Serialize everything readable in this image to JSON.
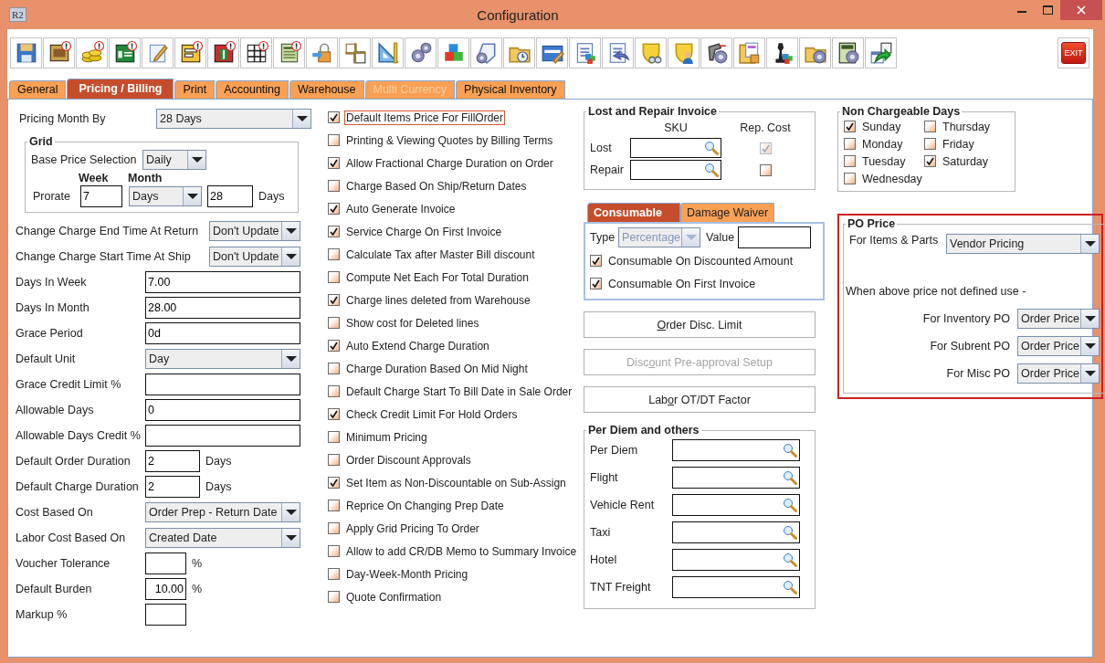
{
  "window": {
    "logo": "R2",
    "title": "Configuration"
  },
  "toolbar": {
    "exit_label": "EXIT"
  },
  "tabs": [
    {
      "label": "General",
      "selected": false,
      "disabled": false
    },
    {
      "label": "Pricing / Billing",
      "selected": true,
      "disabled": false
    },
    {
      "label": "Print",
      "selected": false,
      "disabled": false
    },
    {
      "label": "Accounting",
      "selected": false,
      "disabled": false
    },
    {
      "label": "Warehouse",
      "selected": false,
      "disabled": false
    },
    {
      "label": "Multi Currency",
      "selected": false,
      "disabled": true
    },
    {
      "label": "Physical Inventory",
      "selected": false,
      "disabled": false
    }
  ],
  "pricing_month_by": {
    "label": "Pricing Month By",
    "value": "28 Days"
  },
  "grid": {
    "title": "Grid",
    "base_price_label": "Base Price Selection",
    "base_price_value": "Daily",
    "week_heading": "Week",
    "month_heading": "Month",
    "prorate_label": "Prorate",
    "week_value": "7",
    "month_unit": "Days",
    "month_value": "28",
    "days_label": "Days"
  },
  "fields": [
    {
      "kind": "combo_small",
      "label": "Change Charge End Time At Return",
      "value": "Don't Update"
    },
    {
      "kind": "combo_small",
      "label": "Change Charge Start Time At Ship",
      "value": "Don't Update"
    },
    {
      "kind": "text",
      "label": "Days In Week",
      "value": "7.00"
    },
    {
      "kind": "text",
      "label": "Days In Month",
      "value": "28.00"
    },
    {
      "kind": "text",
      "label": "Grace Period",
      "value": "0d"
    },
    {
      "kind": "combo",
      "label": "Default Unit",
      "value": "Day"
    },
    {
      "kind": "text",
      "label": "Grace Credit Limit %"
    },
    {
      "kind": "text",
      "label": "Allowable Days",
      "value": "0"
    },
    {
      "kind": "text",
      "label": "Allowable Days Credit %"
    },
    {
      "kind": "short",
      "label": "Default Order Duration",
      "value": "2",
      "suffix": "Days"
    },
    {
      "kind": "short",
      "label": "Default Charge Duration",
      "value": "2",
      "suffix": "Days"
    },
    {
      "kind": "combo",
      "label": "Cost Based On",
      "value": "Order Prep - Return Date"
    },
    {
      "kind": "combo",
      "label": "Labor Cost Based On",
      "value": "Created Date"
    },
    {
      "kind": "number",
      "label": "Voucher Tolerance",
      "suffix": "%"
    },
    {
      "kind": "number",
      "label": "Default Burden",
      "value": "10.00",
      "suffix": "%"
    },
    {
      "kind": "number",
      "label": "Markup %"
    }
  ],
  "options": [
    {
      "label": "Default Items Price For FillOrder",
      "checked": true,
      "focused": true
    },
    {
      "label": "Printing & Viewing Quotes by Billing Terms",
      "checked": false,
      "focused": false
    },
    {
      "label": "Allow Fractional Charge Duration on Order",
      "checked": true,
      "focused": false
    },
    {
      "label": "Charge Based On Ship/Return Dates",
      "checked": false,
      "focused": false
    },
    {
      "label": "Auto Generate Invoice",
      "checked": true,
      "focused": false
    },
    {
      "label": "Service Charge On First Invoice",
      "checked": true,
      "focused": false
    },
    {
      "label": "Calculate Tax after Master Bill discount",
      "checked": false,
      "focused": false
    },
    {
      "label": "Compute Net Each For Total Duration",
      "checked": false,
      "focused": false
    },
    {
      "label": "Charge lines deleted from Warehouse",
      "checked": true,
      "focused": false
    },
    {
      "label": "Show cost for Deleted lines",
      "checked": false,
      "focused": false
    },
    {
      "label": "Auto Extend Charge Duration",
      "checked": true,
      "focused": false
    },
    {
      "label": "Charge Duration Based On Mid Night",
      "checked": false,
      "focused": false
    },
    {
      "label": "Default Charge Start To Bill Date in Sale Order",
      "checked": false,
      "focused": false
    },
    {
      "label": "Check Credit Limit For Hold Orders",
      "checked": true,
      "focused": false
    },
    {
      "label": "Minimum Pricing",
      "checked": false,
      "focused": false
    },
    {
      "label": "Order Discount Approvals",
      "checked": false,
      "focused": false
    },
    {
      "label": "Set Item as Non-Discountable on Sub-Assign",
      "checked": true,
      "focused": false
    },
    {
      "label": "Reprice On Changing Prep Date",
      "checked": false,
      "focused": false
    },
    {
      "label": "Apply Grid Pricing To Order",
      "checked": false,
      "focused": false
    },
    {
      "label": "Allow to add CR/DB Memo to Summary Invoice",
      "checked": false,
      "focused": false
    },
    {
      "label": "Day-Week-Month Pricing",
      "checked": false,
      "focused": false
    },
    {
      "label": "Quote Confirmation",
      "checked": false,
      "focused": false
    }
  ],
  "lost_and_repair": {
    "title": "Lost and Repair Invoice",
    "sku_heading": "SKU",
    "rep_cost_heading": "Rep. Cost",
    "rows": [
      {
        "label": "Lost",
        "checked": true,
        "disabled": true
      },
      {
        "label": "Repair",
        "checked": false,
        "disabled": false
      }
    ]
  },
  "sub_tabs": [
    {
      "label": "Consumable",
      "selected": true
    },
    {
      "label": "Damage Waiver",
      "selected": false
    }
  ],
  "consumable": {
    "type_label": "Type",
    "type_value": "Percentage",
    "type_disabled": true,
    "value_label": "Value",
    "options": [
      {
        "label": "Consumable On Discounted Amount",
        "checked": true
      },
      {
        "label": "Consumable On First Invoice",
        "checked": true
      }
    ]
  },
  "buttons": [
    {
      "mnemonic": "O",
      "after": "rder Disc. Limit",
      "disabled": false
    },
    {
      "before": "Disc",
      "mnemonic": "o",
      "after": "unt Pre-approval Setup",
      "disabled": true
    },
    {
      "before": "Lab",
      "mnemonic": "o",
      "after": "r OT/DT Factor",
      "disabled": false
    }
  ],
  "per_diem": {
    "title": "Per Diem and others",
    "rows": [
      "Per Diem",
      "Flight",
      "Vehicle Rent",
      "Taxi",
      "Hotel",
      "TNT Freight"
    ]
  },
  "non_chargeable_days": {
    "title": "Non Chargeable Days",
    "days": [
      {
        "label": "Sunday",
        "checked": true
      },
      {
        "label": "Thursday",
        "checked": false
      },
      {
        "label": "Monday",
        "checked": false
      },
      {
        "label": "Friday",
        "checked": false
      },
      {
        "label": "Tuesday",
        "checked": false
      },
      {
        "label": "Saturday",
        "checked": true
      },
      {
        "label": "Wednesday",
        "checked": false
      }
    ]
  },
  "po_price": {
    "highlighted": true,
    "title": "PO Price",
    "items_label": "For Items & Parts",
    "items_value": "Vendor Pricing",
    "note": "When above price not defined use -",
    "rows": [
      {
        "label": "For Inventory PO",
        "value": "Order Price"
      },
      {
        "label": "For Subrent PO",
        "value": "Order Price"
      },
      {
        "label": "For Misc PO",
        "value": "Order Price"
      }
    ]
  }
}
